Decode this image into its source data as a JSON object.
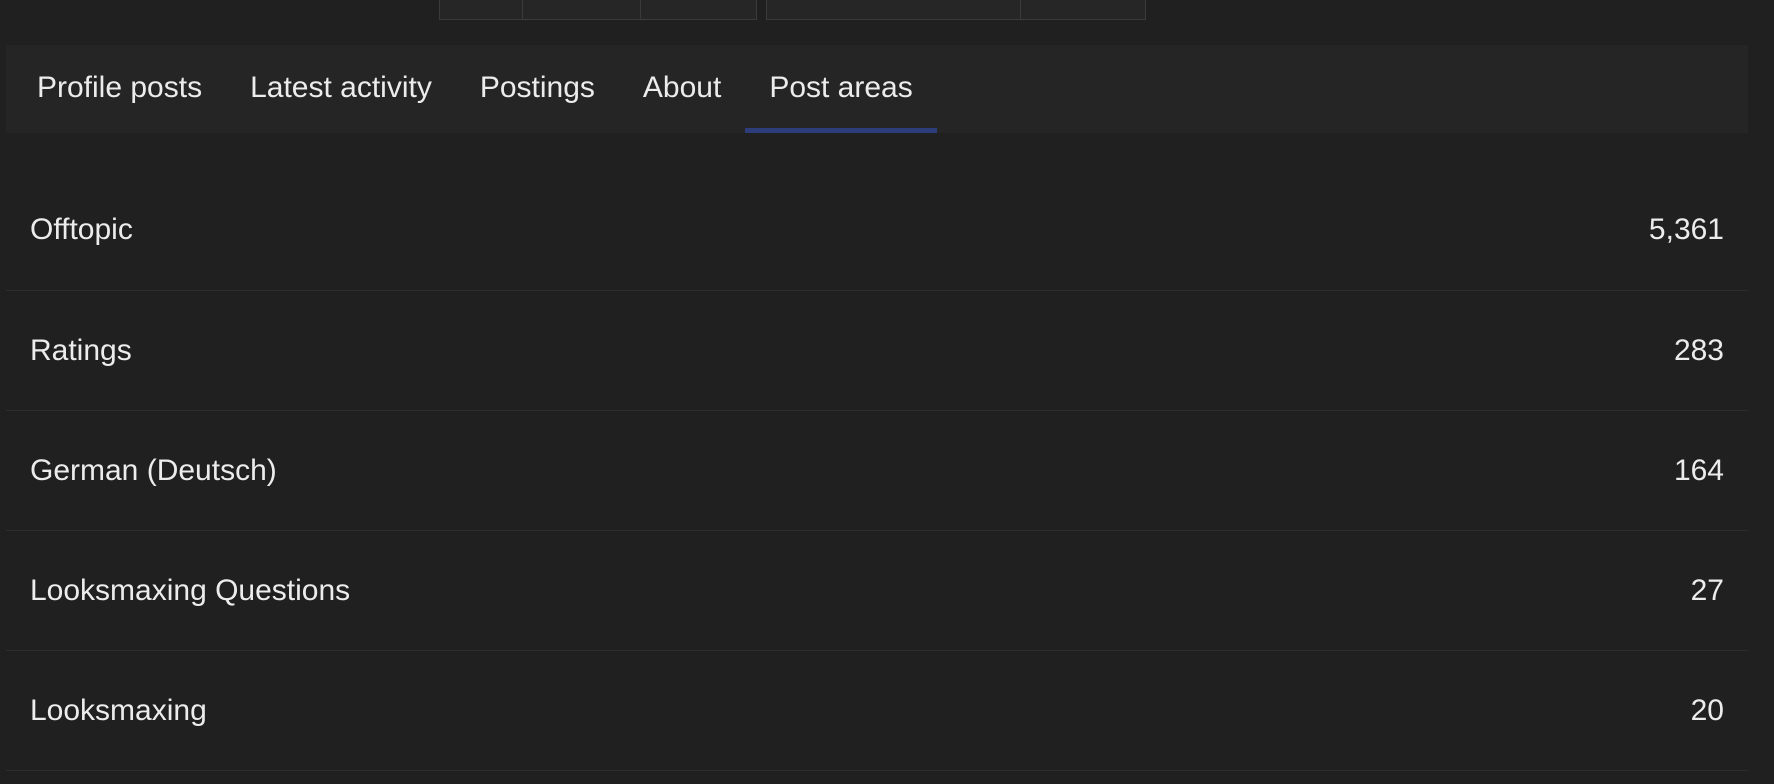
{
  "tabs": [
    {
      "label": "Profile posts",
      "active": false
    },
    {
      "label": "Latest activity",
      "active": false
    },
    {
      "label": "Postings",
      "active": false
    },
    {
      "label": "About",
      "active": false
    },
    {
      "label": "Post areas",
      "active": true
    }
  ],
  "post_areas": [
    {
      "name": "Offtopic",
      "count": "5,361"
    },
    {
      "name": "Ratings",
      "count": "283"
    },
    {
      "name": "German (Deutsch)",
      "count": "164"
    },
    {
      "name": "Looksmaxing Questions",
      "count": "27"
    },
    {
      "name": "Looksmaxing",
      "count": "20"
    }
  ],
  "colors": {
    "background": "#202020",
    "tab_bar": "#252525",
    "active_underline": "#2c3d7a",
    "text": "#ececec",
    "divider": "#2d2d2d"
  }
}
